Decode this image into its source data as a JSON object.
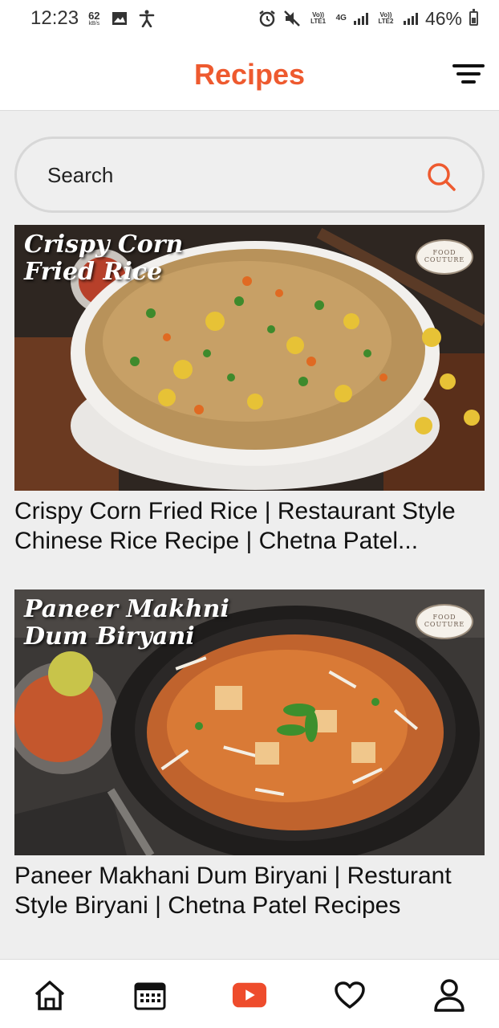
{
  "status_bar": {
    "time": "12:23",
    "speed_value": "62",
    "speed_unit": "kB/s",
    "sim1_label": "Vo)) LTE1",
    "network_type": "4G",
    "sim2_label": "Vo)) LTE2",
    "battery": "46%"
  },
  "header": {
    "title": "Recipes"
  },
  "search": {
    "placeholder": "Search"
  },
  "recipes": [
    {
      "image_overlay_line1": "Crispy Corn",
      "image_overlay_line2": "Fried Rice",
      "brand_line1": "FOOD",
      "brand_line2": "COUTURE",
      "title": "Crispy Corn Fried Rice | Restaurant Style Chinese Rice Recipe | Chetna Patel..."
    },
    {
      "image_overlay_line1": "Paneer Makhni",
      "image_overlay_line2": "Dum Biryani",
      "brand_line1": "FOOD",
      "brand_line2": "COUTURE",
      "title": "Paneer Makhani Dum Biryani | Resturant Style Biryani | Chetna Patel Recipes"
    }
  ],
  "bottom_nav": {
    "items": [
      "home-icon",
      "calendar-icon",
      "youtube-icon",
      "heart-icon",
      "profile-icon"
    ],
    "active_color": "#ee4c2c"
  },
  "colors": {
    "accent": "#ee5a2f",
    "background": "#eeeeee"
  }
}
